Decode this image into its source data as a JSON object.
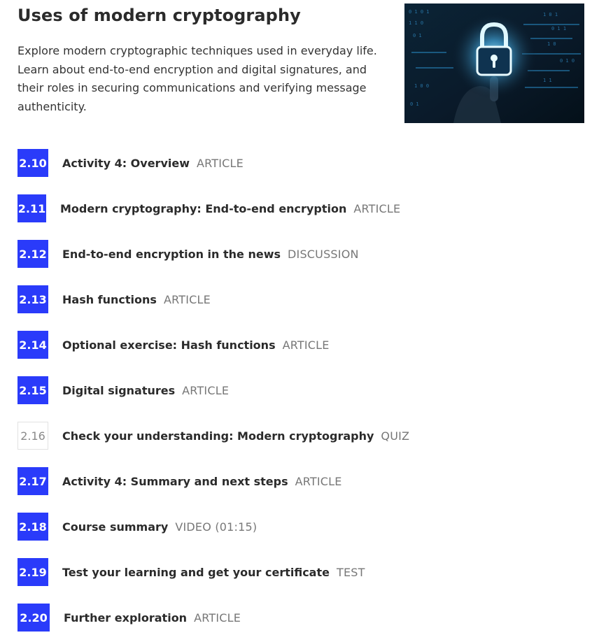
{
  "section": {
    "title": "Uses of modern cryptography",
    "description": "Explore modern cryptographic techniques used in everyday life. Learn about end-to-end encryption and digital signatures, and their roles in securing communications and verifying message authenticity."
  },
  "steps": [
    {
      "number": "2.10",
      "title": "Activity 4: Overview",
      "type": "ARTICLE",
      "status": "complete"
    },
    {
      "number": "2.11",
      "title": "Modern cryptography: End-to-end encryption",
      "type": "ARTICLE",
      "status": "complete"
    },
    {
      "number": "2.12",
      "title": "End-to-end encryption in the news",
      "type": "DISCUSSION",
      "status": "complete"
    },
    {
      "number": "2.13",
      "title": "Hash functions",
      "type": "ARTICLE",
      "status": "complete"
    },
    {
      "number": "2.14",
      "title": "Optional exercise: Hash functions",
      "type": "ARTICLE",
      "status": "complete"
    },
    {
      "number": "2.15",
      "title": "Digital signatures",
      "type": "ARTICLE",
      "status": "complete"
    },
    {
      "number": "2.16",
      "title": "Check your understanding: Modern cryptography",
      "type": "QUIZ",
      "status": "incomplete"
    },
    {
      "number": "2.17",
      "title": "Activity 4: Summary and next steps",
      "type": "ARTICLE",
      "status": "complete"
    },
    {
      "number": "2.18",
      "title": "Course summary",
      "type": "VIDEO (01:15)",
      "status": "complete"
    },
    {
      "number": "2.19",
      "title": "Test your learning and get your certificate",
      "type": "TEST",
      "status": "complete"
    },
    {
      "number": "2.20",
      "title": "Further exploration",
      "type": "ARTICLE",
      "status": "complete"
    }
  ],
  "colors": {
    "step_complete": "#2a3bfa",
    "step_type": "#777777",
    "title_text": "#2b2b2b"
  }
}
